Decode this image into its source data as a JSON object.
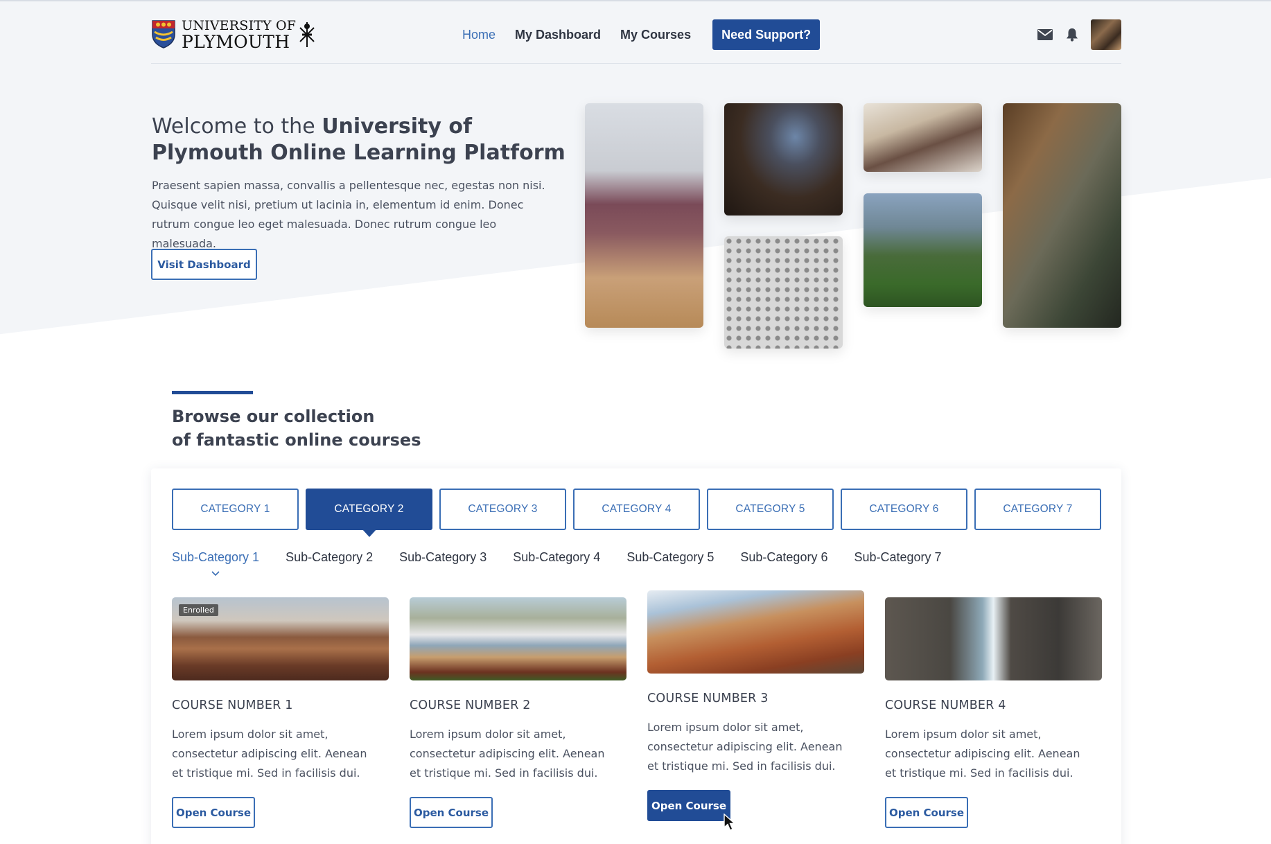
{
  "header": {
    "logo": {
      "line1": "UNIVERSITY OF",
      "line2": "PLYMOUTH"
    },
    "nav": [
      {
        "label": "Home",
        "active": true
      },
      {
        "label": "My Dashboard",
        "active": false
      },
      {
        "label": "My Courses",
        "active": false
      }
    ],
    "support_label": "Need Support?",
    "icons": [
      "mail-icon",
      "bell-icon"
    ]
  },
  "hero": {
    "title_prefix": "Welcome to the ",
    "title_bold": "University of Plymouth Online Learning Platform",
    "description": "Praesent sapien massa, convallis a pellentesque nec, egestas non nisi. Quisque velit nisi, pretium ut lacinia in, elementum id enim. Donec rutrum congue leo eget malesuada. Donec rutrum congue leo malesuada.",
    "cta_label": "Visit Dashboard"
  },
  "browse": {
    "line1": "Browse our collection",
    "line2_prefix": "of ",
    "line2_bold": "fantastic online courses"
  },
  "categories": [
    "CATEGORY 1",
    "CATEGORY 2",
    "CATEGORY 3",
    "CATEGORY 4",
    "CATEGORY 5",
    "CATEGORY 6",
    "CATEGORY 7"
  ],
  "active_category": "CATEGORY 2",
  "subcategories": [
    "Sub-Category 1",
    "Sub-Category 2",
    "Sub-Category 3",
    "Sub-Category 4",
    "Sub-Category 5",
    "Sub-Category 6",
    "Sub-Category 7"
  ],
  "active_subcategory": "Sub-Category 1",
  "courses": [
    {
      "title": "COURSE NUMBER 1",
      "description": "Lorem ipsum dolor sit amet, consectetur adipiscing elit. Aenean et tristique mi. Sed in facilisis dui.",
      "button": "Open Course",
      "badge": "Enrolled"
    },
    {
      "title": "COURSE NUMBER 2",
      "description": "Lorem ipsum dolor sit amet, consectetur adipiscing elit. Aenean et tristique mi. Sed in facilisis dui.",
      "button": "Open Course"
    },
    {
      "title": "COURSE NUMBER 3",
      "description": "Lorem ipsum dolor sit amet, consectetur adipiscing elit. Aenean et tristique mi. Sed in facilisis dui.",
      "button": "Open Course"
    },
    {
      "title": "COURSE NUMBER 4",
      "description": "Lorem ipsum dolor sit amet, consectetur adipiscing elit. Aenean et tristique mi. Sed in facilisis dui.",
      "button": "Open Course"
    }
  ],
  "colors": {
    "brand": "#214c96",
    "link": "#3a6eb5",
    "text": "#3c4250"
  }
}
